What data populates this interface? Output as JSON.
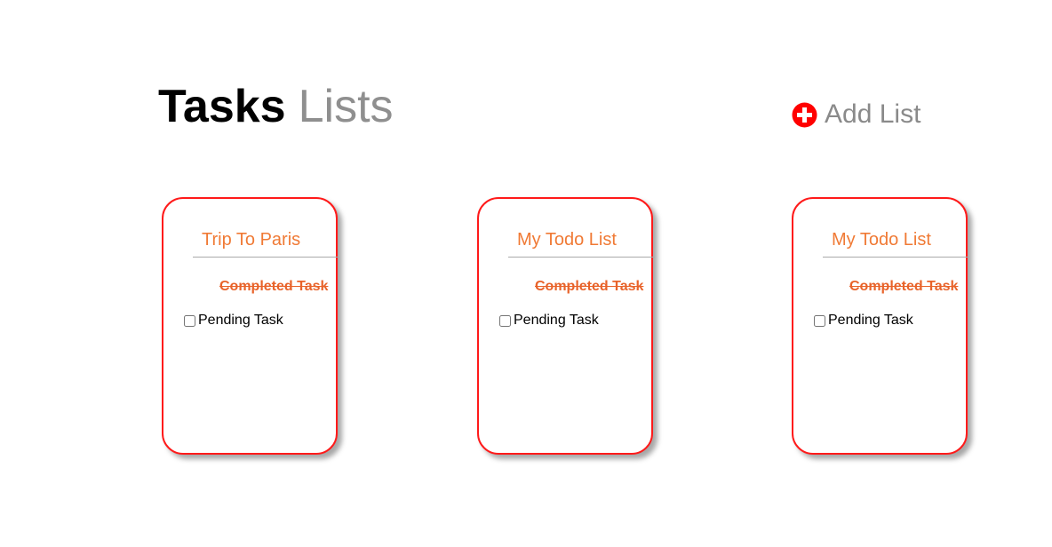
{
  "header": {
    "title_strong": "Tasks",
    "title_light": "Lists",
    "add_list_label": "Add List",
    "add_icon": "plus-circle-icon"
  },
  "colors": {
    "accent": "#ff1a1a",
    "card_title": "#f07a35",
    "completed_task": "#e8632a",
    "muted_text": "#8a8a8a"
  },
  "lists": [
    {
      "title": "Trip To Paris",
      "completed_task": "Completed Task",
      "pending_task": "Pending Task",
      "pending_checked": false
    },
    {
      "title": "My Todo List",
      "completed_task": "Completed Task",
      "pending_task": "Pending Task",
      "pending_checked": false
    },
    {
      "title": "My Todo List",
      "completed_task": "Completed Task",
      "pending_task": "Pending Task",
      "pending_checked": false
    }
  ]
}
